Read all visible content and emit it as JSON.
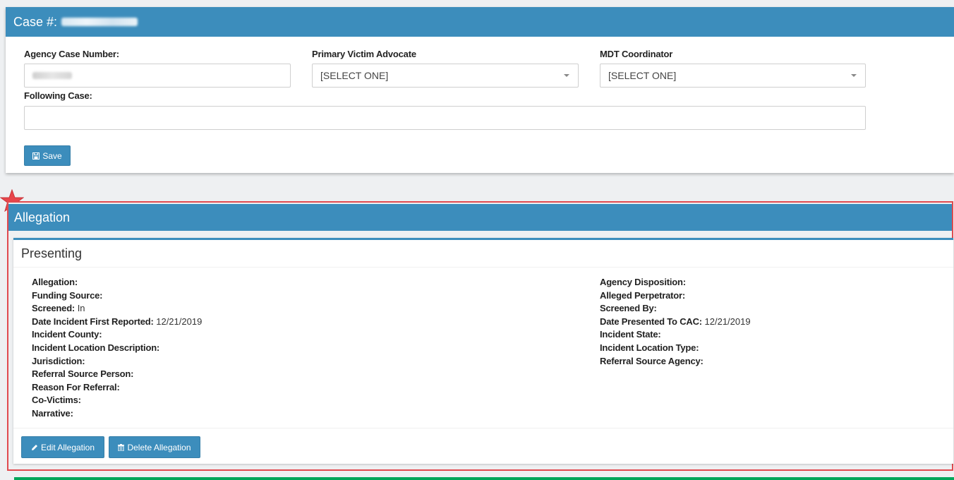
{
  "case_panel": {
    "title": "Case #:",
    "agency_case_number_label": "Agency Case Number:",
    "primary_victim_advocate_label": "Primary Victim Advocate",
    "primary_victim_advocate_value": "[SELECT ONE]",
    "mdt_coordinator_label": "MDT Coordinator",
    "mdt_coordinator_value": "[SELECT ONE]",
    "following_case_label": "Following Case:",
    "following_case_value": "",
    "save_label": "Save"
  },
  "allegation_panel": {
    "title": "Allegation",
    "subpanel_title": "Presenting",
    "left_fields": [
      {
        "label": "Allegation:",
        "value": ""
      },
      {
        "label": "Funding Source:",
        "value": ""
      },
      {
        "label": "Screened:",
        "value": "In"
      },
      {
        "label": "Date Incident First Reported:",
        "value": "12/21/2019"
      },
      {
        "label": "Incident County:",
        "value": ""
      },
      {
        "label": "Incident Location Description:",
        "value": ""
      },
      {
        "label": "Jurisdiction:",
        "value": ""
      },
      {
        "label": "Referral Source Person:",
        "value": ""
      },
      {
        "label": "Reason For Referral:",
        "value": ""
      },
      {
        "label": "Co-Victims:",
        "value": ""
      },
      {
        "label": "Narrative:",
        "value": ""
      }
    ],
    "right_fields": [
      {
        "label": "Agency Disposition:",
        "value": ""
      },
      {
        "label": "Alleged Perpetrator:",
        "value": ""
      },
      {
        "label": "Screened By:",
        "value": ""
      },
      {
        "label": "Date Presented To CAC:",
        "value": "12/21/2019"
      },
      {
        "label": "Incident State:",
        "value": ""
      },
      {
        "label": "Incident Location Type:",
        "value": ""
      },
      {
        "label": "Referral Source Agency:",
        "value": ""
      }
    ],
    "edit_label": "Edit Allegation",
    "delete_label": "Delete Allegation"
  },
  "colors": {
    "header_blue": "#3c8dbc",
    "highlight_red": "#e14a4f",
    "success_green": "#00a65a"
  },
  "icons": [
    "floppy-disk-icon",
    "pencil-icon",
    "trash-icon",
    "star-icon",
    "caret-down-icon"
  ]
}
